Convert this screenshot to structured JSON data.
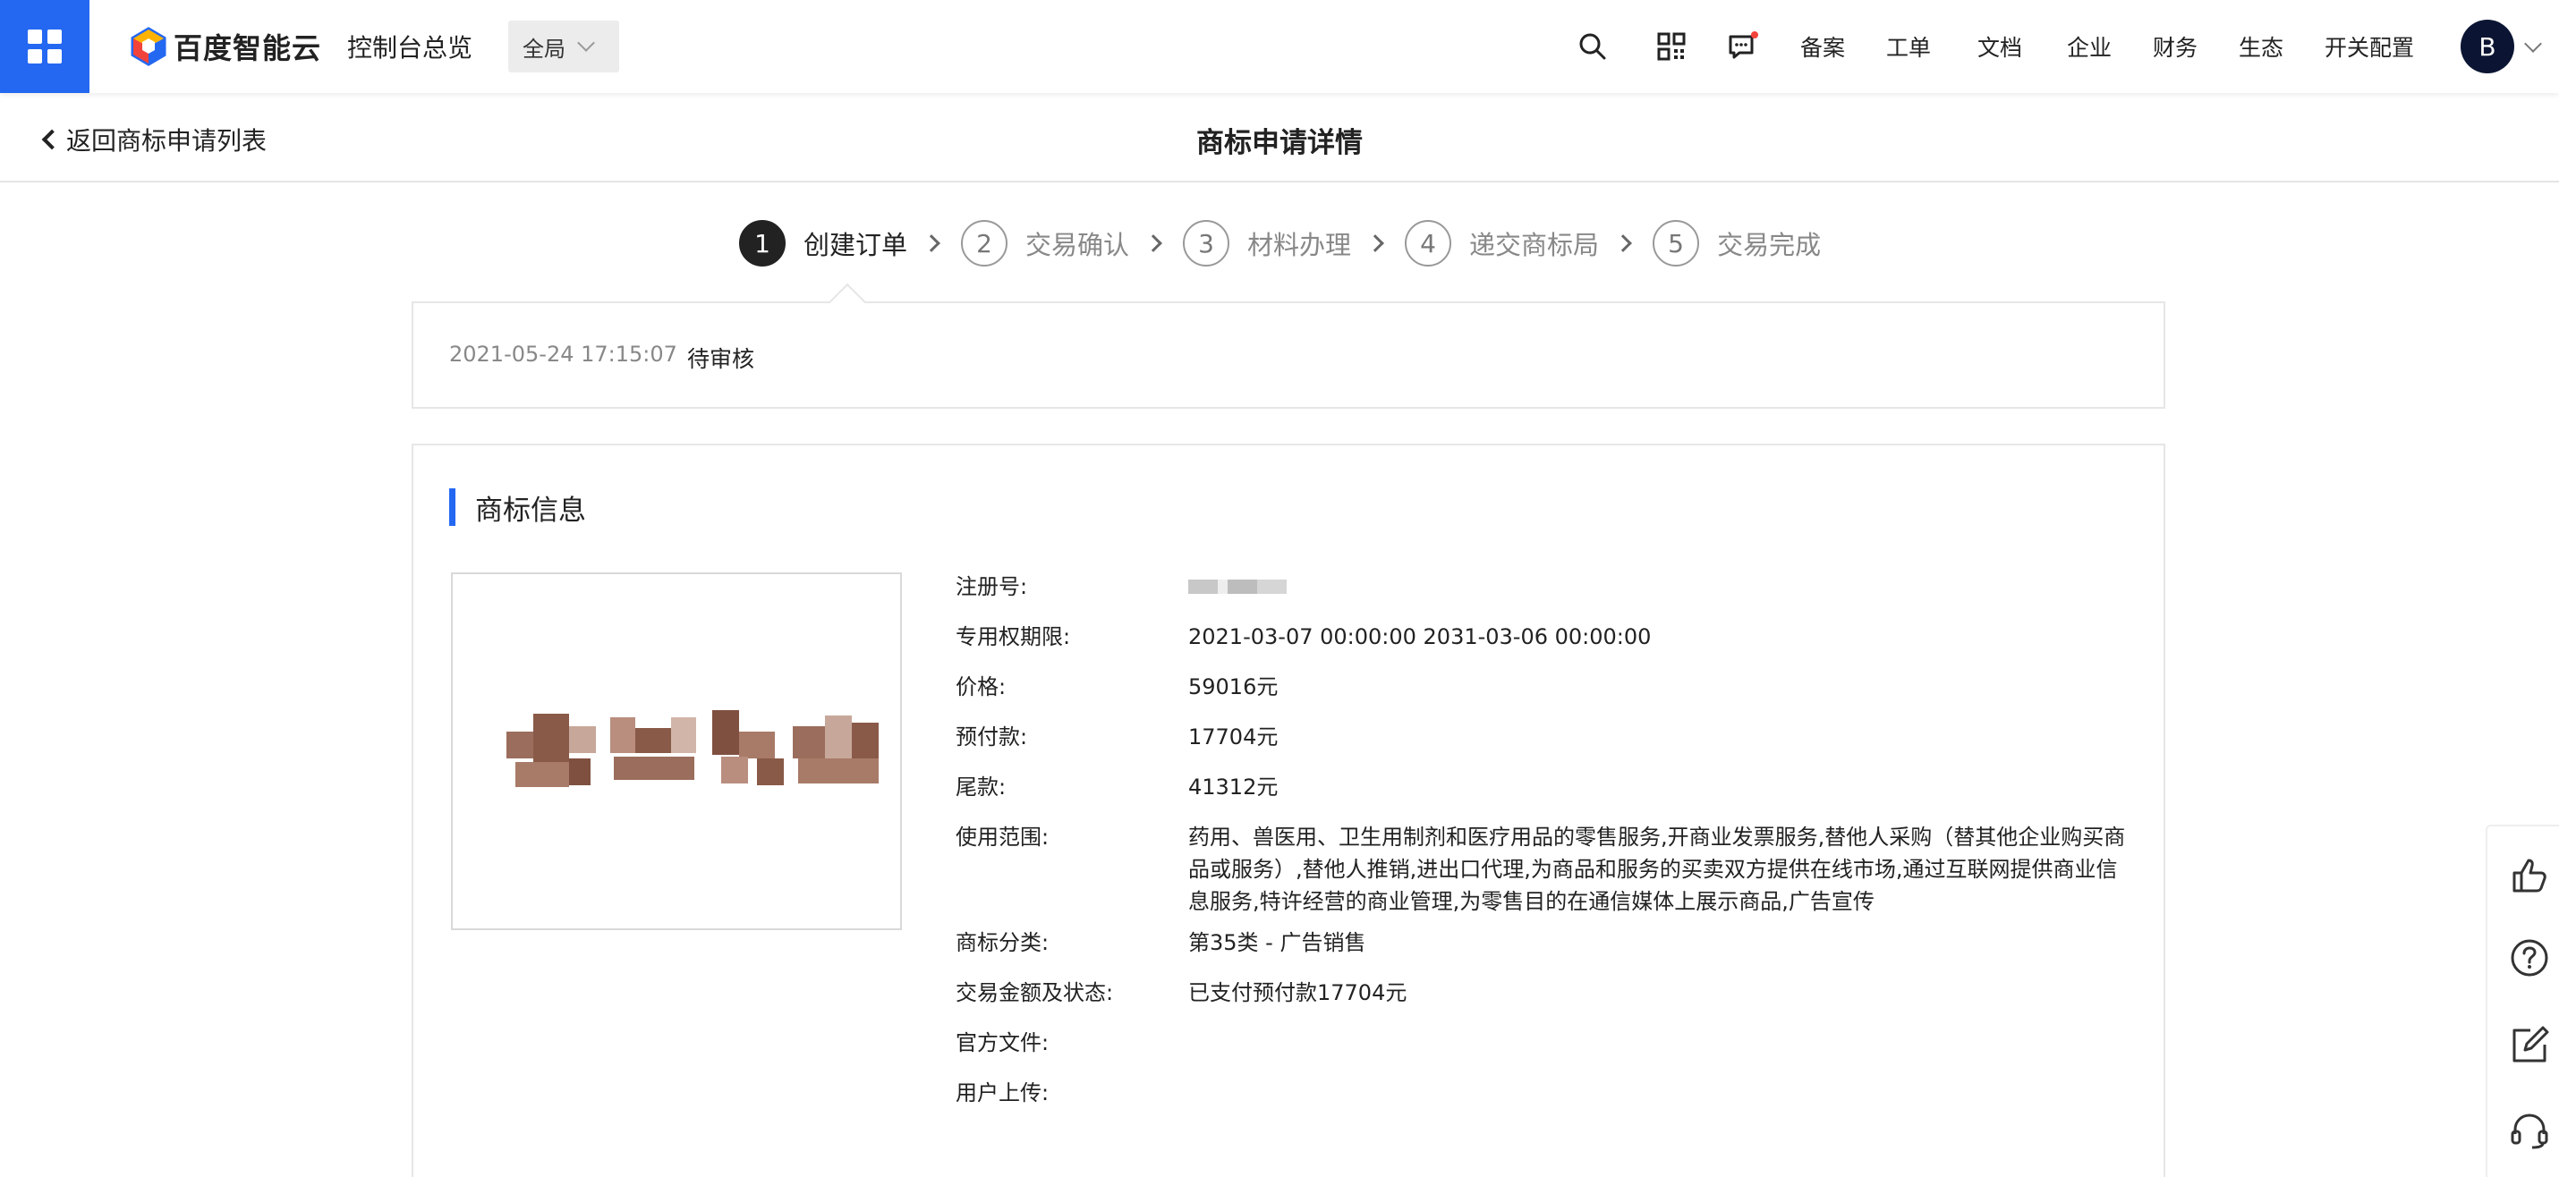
{
  "topbar": {
    "logo_text": "百度智能云",
    "console_link": "控制台总览",
    "region": "全局",
    "nav_links": [
      "备案",
      "工单",
      "文档",
      "企业",
      "财务",
      "生态",
      "开关配置"
    ],
    "avatar_initial": "B",
    "icons": [
      "apps-grid-icon",
      "search-icon",
      "qrcode-icon",
      "message-icon"
    ]
  },
  "subheader": {
    "back_link": "返回商标申请列表",
    "title": "商标申请详情"
  },
  "steps": [
    {
      "num": "1",
      "label": "创建订单",
      "active": true
    },
    {
      "num": "2",
      "label": "交易确认",
      "active": false
    },
    {
      "num": "3",
      "label": "材料办理",
      "active": false
    },
    {
      "num": "4",
      "label": "递交商标局",
      "active": false
    },
    {
      "num": "5",
      "label": "交易完成",
      "active": false
    }
  ],
  "status": {
    "time": "2021-05-24 17:15:07",
    "text": "待审核"
  },
  "trademark": {
    "section_title": "商标信息",
    "fields": [
      {
        "key": "注册号:",
        "value": ""
      },
      {
        "key": "专用权期限:",
        "value": "2021-03-07 00:00:00 2031-03-06 00:00:00"
      },
      {
        "key": "价格:",
        "value": "59016元"
      },
      {
        "key": "预付款:",
        "value": "17704元"
      },
      {
        "key": "尾款:",
        "value": "41312元"
      },
      {
        "key": "使用范围:",
        "value": "药用、兽医用、卫生用制剂和医疗用品的零售服务,开商业发票服务,替他人采购（替其他企业购买商品或服务）,替他人推销,进出口代理,为商品和服务的买卖双方提供在线市场,通过互联网提供商业信息服务,特许经营的商业管理,为零售目的在通信媒体上展示商品,广告宣传"
      },
      {
        "key": "商标分类:",
        "value": "第35类 - 广告销售"
      },
      {
        "key": "交易金额及状态:",
        "value": "已支付预付款17704元"
      },
      {
        "key": "官方文件:",
        "value": ""
      },
      {
        "key": "用户上传:",
        "value": ""
      }
    ]
  },
  "float_tools": [
    "thumbs-up-icon",
    "help-icon",
    "edit-icon",
    "headset-icon"
  ],
  "colors": {
    "accent": "#2468f2",
    "avatar_bg": "#0b1533",
    "tm_mark": "#8a5a48"
  }
}
